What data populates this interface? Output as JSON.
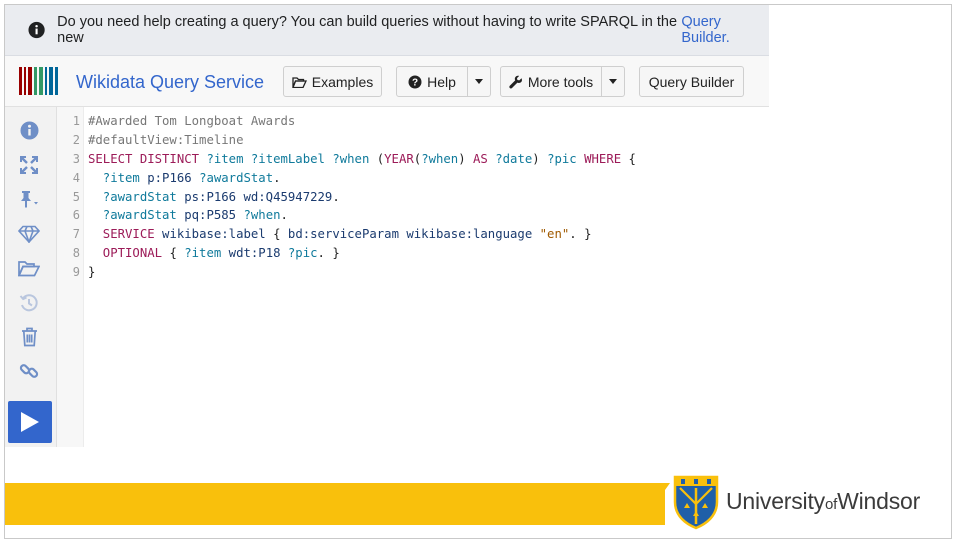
{
  "banner": {
    "text": "Do you need help creating a query? You can build queries without having to write SPARQL in the new",
    "link": "Query Builder."
  },
  "navbar": {
    "brand": "Wikidata Query Service",
    "examples": "Examples",
    "help": "Help",
    "more_tools": "More tools",
    "query_builder": "Query Builder"
  },
  "editor": {
    "line_numbers": [
      "1",
      "2",
      "3",
      "4",
      "5",
      "6",
      "7",
      "8",
      "9"
    ],
    "lines": [
      [
        {
          "t": "#Awarded Tom Longboat Awards",
          "c": "comment"
        }
      ],
      [
        {
          "t": "#defaultView:Timeline",
          "c": "comment"
        }
      ],
      [
        {
          "t": "SELECT DISTINCT ",
          "c": "kw"
        },
        {
          "t": "?item ?itemLabel ?when ",
          "c": "var"
        },
        {
          "t": "(",
          "c": "plain"
        },
        {
          "t": "YEAR",
          "c": "kw"
        },
        {
          "t": "(",
          "c": "plain"
        },
        {
          "t": "?when",
          "c": "var"
        },
        {
          "t": ") ",
          "c": "plain"
        },
        {
          "t": "AS ",
          "c": "kw"
        },
        {
          "t": "?date",
          "c": "var"
        },
        {
          "t": ") ",
          "c": "plain"
        },
        {
          "t": "?pic ",
          "c": "var"
        },
        {
          "t": "WHERE ",
          "c": "kw"
        },
        {
          "t": "{",
          "c": "plain"
        }
      ],
      [
        {
          "t": "  ?item ",
          "c": "var"
        },
        {
          "t": "p:P166 ",
          "c": "pref"
        },
        {
          "t": "?awardStat",
          "c": "var"
        },
        {
          "t": ".",
          "c": "plain"
        }
      ],
      [
        {
          "t": "  ?awardStat ",
          "c": "var"
        },
        {
          "t": "ps:P166 wd:Q45947229",
          "c": "pref"
        },
        {
          "t": ".",
          "c": "plain"
        }
      ],
      [
        {
          "t": "  ?awardStat ",
          "c": "var"
        },
        {
          "t": "pq:P585 ",
          "c": "pref"
        },
        {
          "t": "?when",
          "c": "var"
        },
        {
          "t": ".",
          "c": "plain"
        }
      ],
      [
        {
          "t": "  SERVICE ",
          "c": "kw"
        },
        {
          "t": "wikibase:label ",
          "c": "pref"
        },
        {
          "t": "{ ",
          "c": "plain"
        },
        {
          "t": "bd:serviceParam wikibase:language ",
          "c": "pref"
        },
        {
          "t": "\"en\"",
          "c": "str"
        },
        {
          "t": ". }",
          "c": "plain"
        }
      ],
      [
        {
          "t": "  OPTIONAL ",
          "c": "kw"
        },
        {
          "t": "{ ",
          "c": "plain"
        },
        {
          "t": "?item ",
          "c": "var"
        },
        {
          "t": "wdt:P18 ",
          "c": "pref"
        },
        {
          "t": "?pic",
          "c": "var"
        },
        {
          "t": ". }",
          "c": "plain"
        }
      ],
      [
        {
          "t": "}",
          "c": "plain"
        }
      ]
    ]
  },
  "footer": {
    "university": "University",
    "of": "of",
    "windsor": "Windsor"
  },
  "colors": {
    "accent": "#3366cc",
    "footer_yellow": "#f9c00c"
  },
  "icons": {
    "sidebar": [
      "info-icon",
      "expand-icon",
      "pin-icon",
      "diamond-icon",
      "folder-icon",
      "history-icon",
      "trash-icon",
      "link-icon",
      "play-icon"
    ]
  }
}
